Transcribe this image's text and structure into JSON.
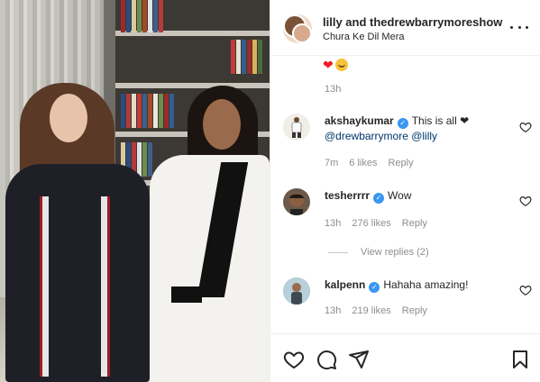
{
  "header": {
    "title": "lilly and thedrewbarrymoreshow",
    "subtitle": "Chura Ke Dil Mera"
  },
  "previous_reply": {
    "emoji": "❤️🥰",
    "time": "13h"
  },
  "comments": [
    {
      "username": "akshaykumar",
      "verified": true,
      "text": "This is all ❤",
      "mentions": "@drewbarrymore @lilly",
      "time": "7m",
      "likes": "6 likes",
      "reply_label": "Reply"
    },
    {
      "username": "tesherrrr",
      "verified": true,
      "text": "Wow",
      "time": "13h",
      "likes": "276 likes",
      "reply_label": "Reply",
      "view_replies": "View replies (2)"
    },
    {
      "username": "kalpenn",
      "verified": true,
      "text": "Hahaha amazing!",
      "time": "13h",
      "likes": "219 likes",
      "reply_label": "Reply"
    }
  ],
  "colors": {
    "verified_badge": "#3897f0",
    "mention": "#00376b",
    "meta_text": "#8e8e8e"
  },
  "icons": {
    "header_menu": "more-horizontal-icon",
    "comment_like": "heart-outline-icon",
    "actions": [
      "heart-outline-icon",
      "comment-icon",
      "share-icon",
      "bookmark-icon"
    ]
  }
}
